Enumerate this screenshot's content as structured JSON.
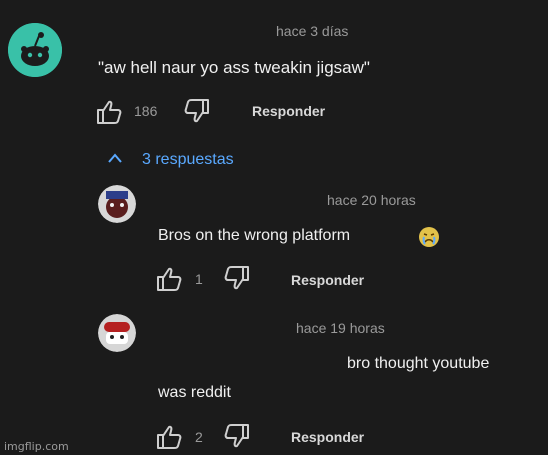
{
  "comment": {
    "time": "hace 3 días",
    "text": "\"aw hell naur yo ass tweakin jigsaw\"",
    "likes": "186",
    "reply_label": "Responder"
  },
  "replies_toggle": {
    "label": "3 respuestas"
  },
  "replies": [
    {
      "time": "hace 20 horas",
      "text": "Bros on the wrong platform",
      "likes": "1",
      "reply_label": "Responder"
    },
    {
      "time": "hace 19 horas",
      "text_line1": "bro thought youtube",
      "text_line2": "was reddit",
      "likes": "2",
      "reply_label": "Responder"
    }
  ],
  "watermark": "imgflip.com",
  "colors": {
    "background": "#1b1b1b",
    "link": "#5aa9ff",
    "reddit_avatar": "#39c1a8"
  }
}
